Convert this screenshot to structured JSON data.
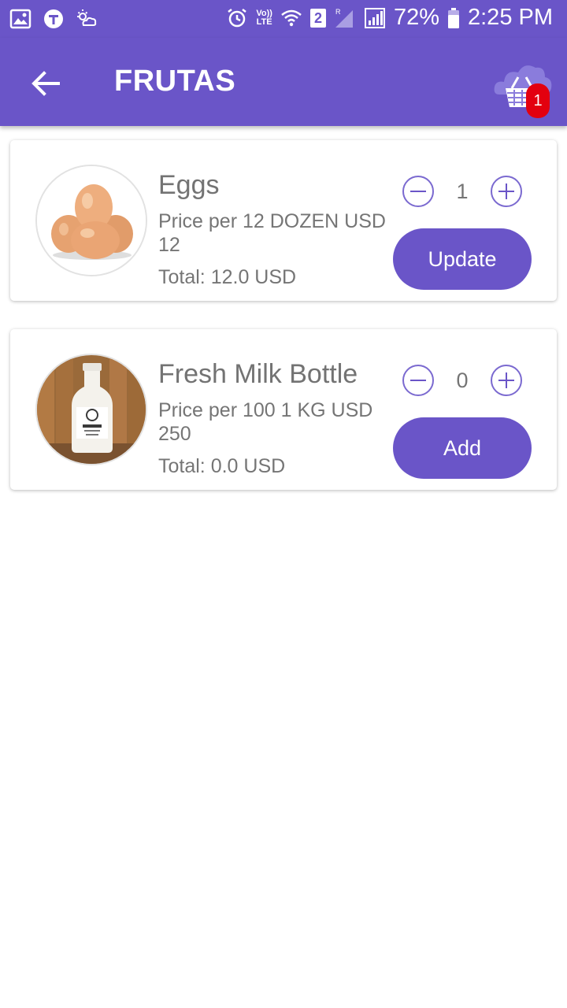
{
  "status_bar": {
    "battery": "72%",
    "time": "2:25 PM",
    "sim_slot": "2",
    "network_label": "LTE",
    "icons": [
      "gallery-icon",
      "t-app-icon",
      "weather-icon",
      "alarm-icon",
      "volte-icon",
      "wifi-icon",
      "signal-icon",
      "battery-icon"
    ]
  },
  "app_bar": {
    "title": "FRUTAS",
    "cart_badge": "1",
    "icons": [
      "back-arrow-icon",
      "basket-icon"
    ]
  },
  "products": [
    {
      "name": "Eggs",
      "price_line": "Price per 12 DOZEN USD  12",
      "total": "Total: 12.0 USD",
      "quantity": "1",
      "action_label": "Update",
      "image": "eggs-image"
    },
    {
      "name": "Fresh Milk Bottle",
      "price_line": "Price per 100 1 KG USD 250",
      "total": "Total: 0.0 USD",
      "quantity": "0",
      "action_label": "Add",
      "image": "milk-bottle-image"
    }
  ],
  "colors": {
    "primary": "#6a55c8",
    "badge": "#e3000f",
    "text_gray": "#757575"
  }
}
